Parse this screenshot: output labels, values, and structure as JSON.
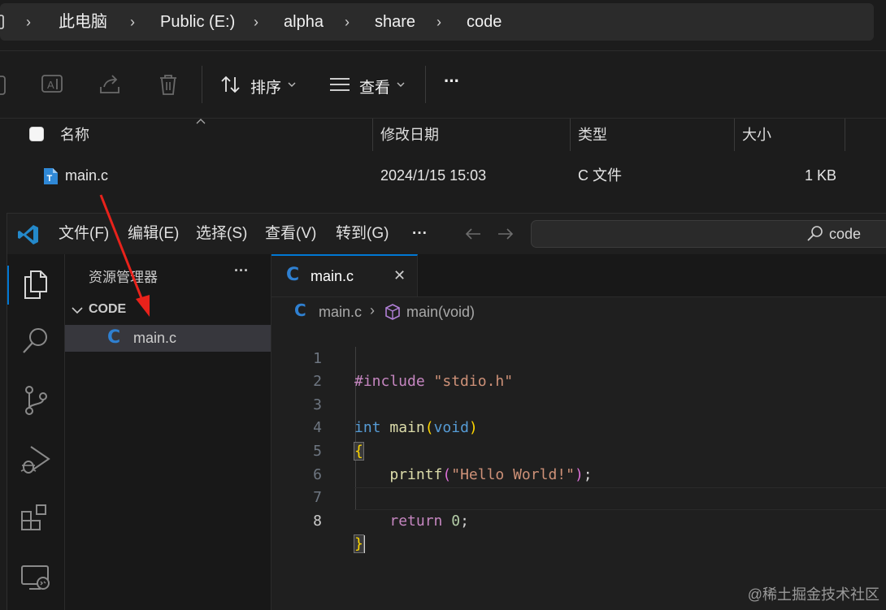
{
  "explorer": {
    "breadcrumb": [
      "此电脑",
      "Public (E:)",
      "alpha",
      "share",
      "code"
    ],
    "toolbar": {
      "sort_label": "排序",
      "view_label": "查看",
      "more_label": "···"
    },
    "columns": {
      "name": "名称",
      "date": "修改日期",
      "type": "类型",
      "size": "大小"
    },
    "files": [
      {
        "name": "main.c",
        "date": "2024/1/15 15:03",
        "type": "C 文件",
        "size": "1 KB"
      }
    ]
  },
  "vscode": {
    "menu": [
      "文件(F)",
      "编辑(E)",
      "选择(S)",
      "查看(V)",
      "转到(G)",
      "···"
    ],
    "search_text": "code",
    "sidebar": {
      "title": "资源管理器",
      "more": "···",
      "folder": "CODE",
      "files": [
        "main.c"
      ]
    },
    "tab": {
      "label": "main.c",
      "close": "✕"
    },
    "breadcrumb": {
      "file": "main.c",
      "symbol": "main(void)"
    },
    "code_lines": [
      {
        "n": "1",
        "text": "#include \"stdio.h\""
      },
      {
        "n": "2",
        "text": ""
      },
      {
        "n": "3",
        "text": "int main(void)"
      },
      {
        "n": "4",
        "text": "{"
      },
      {
        "n": "5",
        "text": "    printf(\"Hello World!\");"
      },
      {
        "n": "6",
        "text": ""
      },
      {
        "n": "7",
        "text": "    return 0;"
      },
      {
        "n": "8",
        "text": "}"
      }
    ]
  },
  "watermark": "@稀土掘金技术社区",
  "colors": {
    "accent": "#0078d4",
    "arrow": "#e8221b",
    "c_icon": "#2f80d1"
  }
}
